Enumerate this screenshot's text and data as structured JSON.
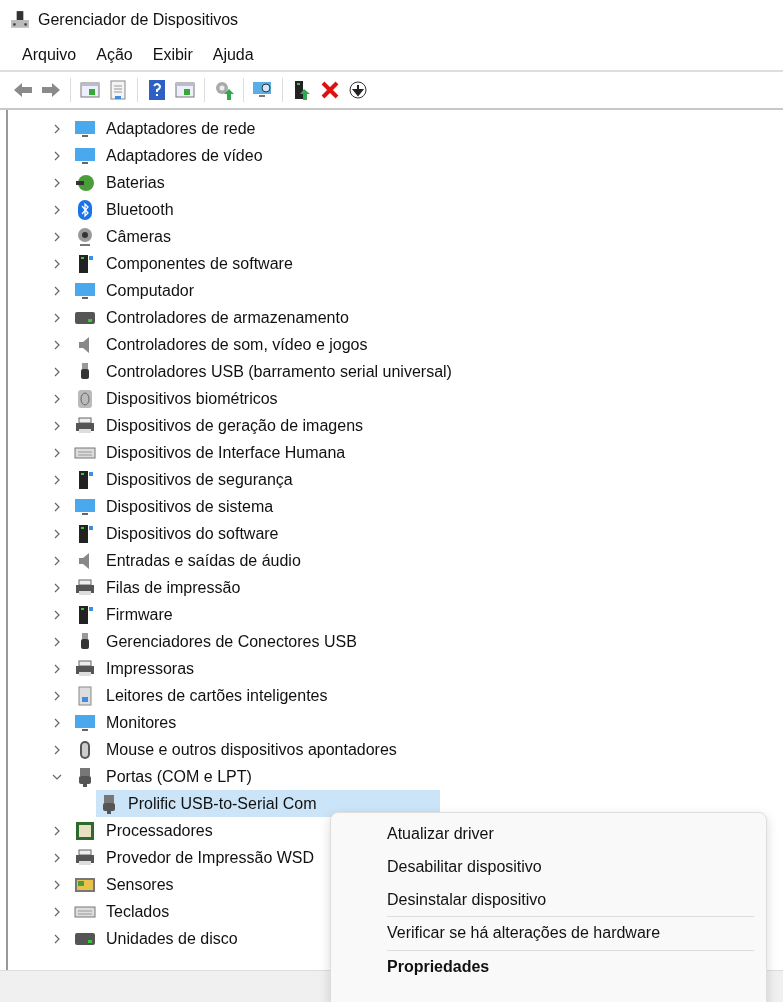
{
  "window": {
    "title": "Gerenciador de Dispositivos"
  },
  "menu_bar": [
    "Arquivo",
    "Ação",
    "Exibir",
    "Ajuda"
  ],
  "tree": [
    {
      "label": "Adaptadores de rede",
      "expanded": false,
      "selected": false
    },
    {
      "label": "Adaptadores de vídeo",
      "expanded": false,
      "selected": false
    },
    {
      "label": "Baterias",
      "expanded": false,
      "selected": false
    },
    {
      "label": "Bluetooth",
      "expanded": false,
      "selected": false
    },
    {
      "label": "Câmeras",
      "expanded": false,
      "selected": false
    },
    {
      "label": "Componentes de software",
      "expanded": false,
      "selected": false
    },
    {
      "label": "Computador",
      "expanded": false,
      "selected": false
    },
    {
      "label": "Controladores de armazenamento",
      "expanded": false,
      "selected": false
    },
    {
      "label": "Controladores de som, vídeo e jogos",
      "expanded": false,
      "selected": false
    },
    {
      "label": "Controladores USB (barramento serial universal)",
      "expanded": false,
      "selected": false
    },
    {
      "label": "Dispositivos biométricos",
      "expanded": false,
      "selected": false
    },
    {
      "label": "Dispositivos de geração de imagens",
      "expanded": false,
      "selected": false
    },
    {
      "label": "Dispositivos de Interface Humana",
      "expanded": false,
      "selected": false
    },
    {
      "label": "Dispositivos de segurança",
      "expanded": false,
      "selected": false
    },
    {
      "label": "Dispositivos de sistema",
      "expanded": false,
      "selected": false
    },
    {
      "label": "Dispositivos do software",
      "expanded": false,
      "selected": false
    },
    {
      "label": "Entradas e saídas de áudio",
      "expanded": false,
      "selected": false
    },
    {
      "label": "Filas de impressão",
      "expanded": false,
      "selected": false
    },
    {
      "label": "Firmware",
      "expanded": false,
      "selected": false
    },
    {
      "label": "Gerenciadores de Conectores USB",
      "expanded": false,
      "selected": false
    },
    {
      "label": "Impressoras",
      "expanded": false,
      "selected": false
    },
    {
      "label": "Leitores de cartões inteligentes",
      "expanded": false,
      "selected": false
    },
    {
      "label": "Monitores",
      "expanded": false,
      "selected": false
    },
    {
      "label": "Mouse e outros dispositivos apontadores",
      "expanded": false,
      "selected": false
    },
    {
      "label": "Portas (COM e LPT)",
      "expanded": true,
      "selected": false,
      "children": [
        {
          "label": "Prolific USB-to-Serial Com",
          "selected": true
        }
      ]
    },
    {
      "label": "Processadores",
      "expanded": false,
      "selected": false
    },
    {
      "label": "Provedor de Impressão WSD",
      "expanded": false,
      "selected": false
    },
    {
      "label": "Sensores",
      "expanded": false,
      "selected": false
    },
    {
      "label": "Teclados",
      "expanded": false,
      "selected": false
    },
    {
      "label": "Unidades de disco",
      "expanded": false,
      "selected": false
    }
  ],
  "context_menu": [
    {
      "label": "Atualizar driver",
      "separator_before": false,
      "default": false
    },
    {
      "label": "Desabilitar dispositivo",
      "separator_before": false,
      "default": false
    },
    {
      "label": "Desinstalar dispositivo",
      "separator_before": false,
      "default": false
    },
    {
      "label": "Verificar se há alterações de hardware",
      "separator_before": true,
      "default": false
    },
    {
      "label": "Propriedades",
      "separator_before": true,
      "default": true
    }
  ]
}
